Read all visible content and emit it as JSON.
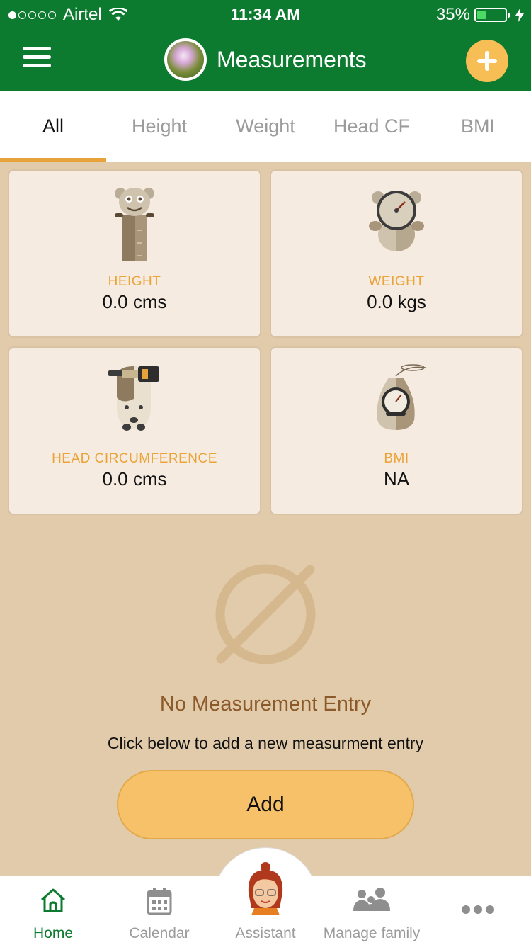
{
  "status_bar": {
    "carrier": "Airtel",
    "time": "11:34 AM",
    "battery_percent": "35%",
    "battery_level": 0.35
  },
  "header": {
    "title": "Measurements",
    "menu_icon": "hamburger-menu-icon",
    "add_icon": "plus-icon"
  },
  "tabs": [
    {
      "label": "All",
      "active": true
    },
    {
      "label": "Height",
      "active": false
    },
    {
      "label": "Weight",
      "active": false
    },
    {
      "label": "Head CF",
      "active": false
    },
    {
      "label": "BMI",
      "active": false
    }
  ],
  "cards": [
    {
      "label": "HEIGHT",
      "value": "0.0 cms",
      "icon": "height-ruler-bear-icon"
    },
    {
      "label": "WEIGHT",
      "value": "0.0 kgs",
      "icon": "weight-scale-bear-icon"
    },
    {
      "label": "HEAD CIRCUMFERENCE",
      "value": "0.0 cms",
      "icon": "head-measure-tape-icon"
    },
    {
      "label": "BMI",
      "value": "NA",
      "icon": "bmi-gauge-icon"
    }
  ],
  "empty_state": {
    "title": "No Measurement Entry",
    "subtitle": "Click below to add a new measurment entry",
    "button_label": "Add",
    "icon": "empty-set-icon"
  },
  "bottom_nav": [
    {
      "label": "Home",
      "icon": "home-icon",
      "active": true
    },
    {
      "label": "Calendar",
      "icon": "calendar-icon",
      "active": false
    },
    {
      "label": "Assistant",
      "icon": "assistant-avatar-icon",
      "active": false
    },
    {
      "label": "Manage family",
      "icon": "family-icon",
      "active": false
    },
    {
      "label": "",
      "icon": "more-dots-icon",
      "active": false
    }
  ],
  "colors": {
    "primary_green": "#0c7b2f",
    "accent_orange": "#eba337",
    "background_tan": "#e2cbab",
    "button_yellow": "#f7c16a"
  }
}
